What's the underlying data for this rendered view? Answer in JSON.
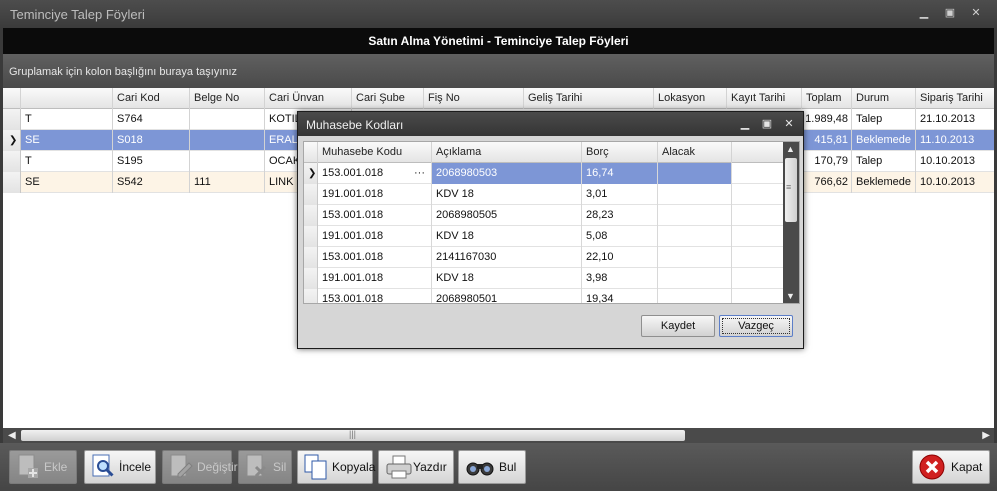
{
  "window": {
    "title": "Temінciye Talep Föyleri"
  },
  "header": {
    "title": "Satın Alma Yönetimi - Teminciye Talep Föyleri"
  },
  "group_panel": {
    "hint": "Gruplamak için kolon başlığını buraya taşıyınız"
  },
  "grid": {
    "columns": [
      "",
      "Cari Kod",
      "Belge No",
      "Cari Ünvan",
      "Cari Şube",
      "Fiş No",
      "Geliş Tarihi",
      "Lokasyon",
      "Kayıt Tarihi",
      "Toplam",
      "Durum",
      "Sipariş Tarihi"
    ],
    "rows": [
      [
        "T",
        "S764",
        "",
        "KOTIL",
        "",
        "",
        "",
        "",
        "",
        "1.989,48",
        "Talep",
        "21.10.2013"
      ],
      [
        "SE",
        "S018",
        "",
        "ERAL",
        "",
        "",
        "",
        "",
        "",
        "415,81",
        "Beklemede",
        "11.10.2013"
      ],
      [
        "T",
        "S195",
        "",
        "OCAK",
        "",
        "",
        "",
        "",
        "",
        "170,79",
        "Talep",
        "10.10.2013"
      ],
      [
        "SE",
        "S542",
        "111",
        "LINK G",
        "",
        "",
        "",
        "",
        "",
        "766,62",
        "Beklemede",
        "10.10.2013"
      ]
    ]
  },
  "toolbar": {
    "ekle": "Ekle",
    "incele": "İncele",
    "degistir": "Değiştir",
    "sil": "Sil",
    "kopyala": "Kopyala",
    "yazdir": "Yazdır",
    "bul": "Bul",
    "kapat": "Kapat"
  },
  "dialog": {
    "title": "Muhasebe Kodları",
    "columns": [
      "Muhasebe Kodu",
      "Açıklama",
      "Borç",
      "Alacak"
    ],
    "rows": [
      [
        "153.001.018",
        "2068980503",
        "16,74",
        ""
      ],
      [
        "191.001.018",
        "KDV 18",
        "3,01",
        ""
      ],
      [
        "153.001.018",
        "2068980505",
        "28,23",
        ""
      ],
      [
        "191.001.018",
        "KDV 18",
        "5,08",
        ""
      ],
      [
        "153.001.018",
        "2141167030",
        "22,10",
        ""
      ],
      [
        "191.001.018",
        "KDV 18",
        "3,98",
        ""
      ],
      [
        "153.001.018",
        "2068980501",
        "19,34",
        ""
      ]
    ],
    "ellipsis": "···",
    "save": "Kaydet",
    "cancel": "Vazgeç"
  }
}
